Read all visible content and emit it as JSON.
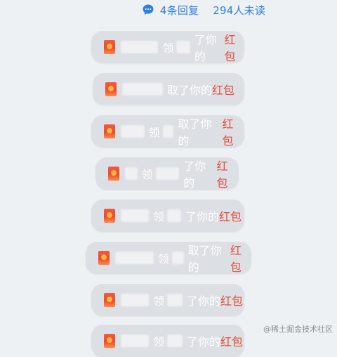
{
  "header": {
    "replies": "4条回复",
    "unread": "294人未读"
  },
  "messages": [
    {
      "left_text": "领",
      "action": "了你的",
      "highlight": "红包"
    },
    {
      "left_text": "取",
      "action": "了你的",
      "highlight": "红包"
    },
    {
      "left_text": "领",
      "action": "取了你的",
      "highlight": "红包"
    },
    {
      "left_text": "领",
      "action": "了你的",
      "highlight": "红包"
    },
    {
      "left_text": "领",
      "action": "了你的",
      "highlight": "红包"
    },
    {
      "left_text": "领",
      "action": "取了你的",
      "highlight": "红包"
    },
    {
      "left_text": "领",
      "action": "了你的",
      "highlight": "红包"
    },
    {
      "left_text": "领",
      "action": "了你的",
      "highlight": "红包"
    }
  ],
  "watermark": "@稀土掘金技术社区",
  "colors": {
    "accent": "#2f7fe0",
    "highlight": "#e44e3b",
    "bubble": "#dcdfe3",
    "background": "#eef1f4"
  }
}
